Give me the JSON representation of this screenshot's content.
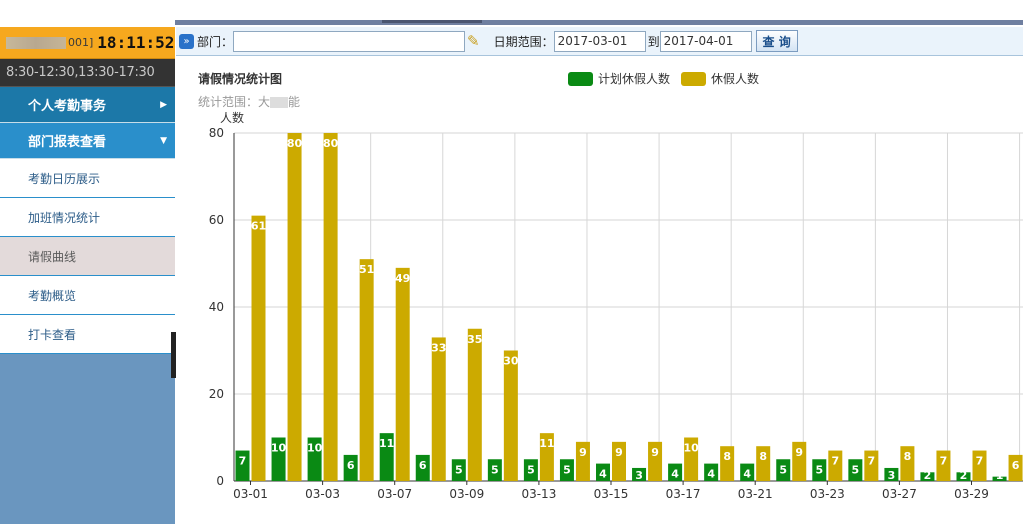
{
  "sidebar": {
    "user_id": "001]",
    "clock": "18:11:52",
    "shift_hours": "8:30-12:30,13:30-17:30",
    "menu_personal": "个人考勤事务",
    "menu_department": "部门报表查看",
    "items": [
      {
        "label": "考勤日历展示"
      },
      {
        "label": "加班情况统计"
      },
      {
        "label": "请假曲线"
      },
      {
        "label": "考勤概览"
      },
      {
        "label": "打卡查看"
      }
    ],
    "active_item": "请假曲线"
  },
  "toolbar": {
    "dept_label": "部门：",
    "dept_value": "",
    "date_range_label": "日期范围：",
    "date_from": "2017-03-01",
    "to_label": "到",
    "date_to": "2017-04-01",
    "query_label": "查 询"
  },
  "chart_header": {
    "title": "请假情况统计图",
    "scope_label": "统计范围：大",
    "scope_suffix": "能"
  },
  "chart_data": {
    "type": "bar",
    "title": "请假情况统计图",
    "ylabel": "人数",
    "ylim": [
      0,
      80
    ],
    "yticks": [
      0,
      20,
      40,
      60,
      80
    ],
    "grid": true,
    "legend_position": "top",
    "x_tick_labels": [
      "03-01",
      "03-03",
      "03-07",
      "03-09",
      "03-13",
      "03-15",
      "03-17",
      "03-21",
      "03-23",
      "03-27",
      "03-29"
    ],
    "categories": [
      "03-01",
      "03-02",
      "03-03",
      "03-06",
      "03-07",
      "03-08",
      "03-09",
      "03-10",
      "03-13",
      "03-14",
      "03-15",
      "03-16",
      "03-17",
      "03-20",
      "03-21",
      "03-22",
      "03-23",
      "03-24",
      "03-27",
      "03-28",
      "03-29",
      "03-30"
    ],
    "series": [
      {
        "name": "计划休假人数",
        "color": "#0a8a14",
        "values": [
          7,
          10,
          10,
          6,
          11,
          6,
          5,
          5,
          5,
          5,
          4,
          3,
          4,
          4,
          4,
          5,
          5,
          5,
          3,
          2,
          2,
          1
        ]
      },
      {
        "name": "休假人数",
        "color": "#ccaa00",
        "values": [
          61,
          80,
          80,
          51,
          49,
          33,
          35,
          30,
          11,
          9,
          9,
          9,
          10,
          8,
          8,
          9,
          7,
          7,
          8,
          7,
          7,
          6
        ]
      }
    ]
  }
}
